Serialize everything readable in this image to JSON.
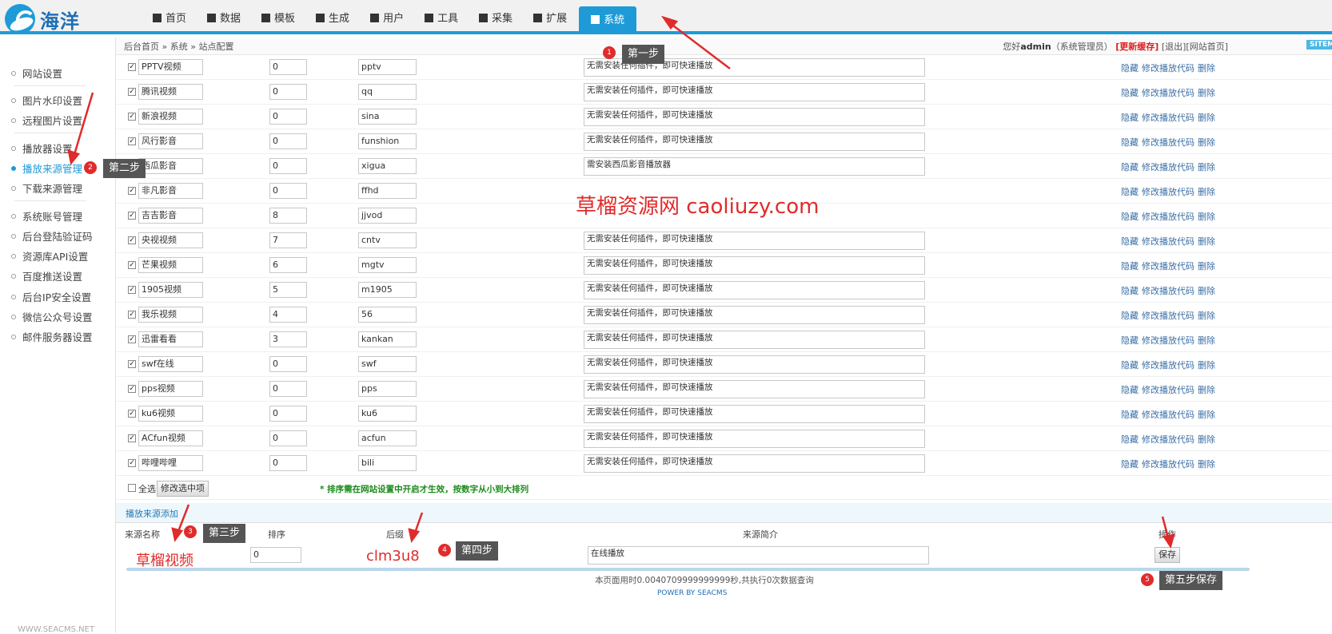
{
  "logo": {
    "text": "海洋"
  },
  "nav": [
    {
      "label": "首页",
      "icon": "home-icon"
    },
    {
      "label": "数据",
      "icon": "book-icon"
    },
    {
      "label": "模板",
      "icon": "file-icon"
    },
    {
      "label": "生成",
      "icon": "tasks-icon"
    },
    {
      "label": "用户",
      "icon": "users-icon"
    },
    {
      "label": "工具",
      "icon": "wrench-icon"
    },
    {
      "label": "采集",
      "icon": "magnet-icon"
    },
    {
      "label": "扩展",
      "icon": "sitemap-icon"
    },
    {
      "label": "系统",
      "icon": "edit-icon",
      "active": true
    }
  ],
  "breadcrumb": "后台首页 » 系统 » 站点配置",
  "user": {
    "greeting": "您好",
    "name": "admin",
    "role": "（系统管理员）",
    "refresh": "[更新缓存]",
    "logout": "[退出]",
    "site_home": "[网站首页]",
    "sitemap": "SITEMAP"
  },
  "sidebar": {
    "items": [
      "网站设置",
      "图片水印设置",
      "远程图片设置",
      "播放器设置",
      "播放来源管理",
      "下载来源管理",
      "系统账号管理",
      "后台登陆验证码",
      "资源库API设置",
      "百度推送设置",
      "后台IP安全设置",
      "微信公众号设置",
      "邮件服务器设置"
    ],
    "active_index": 4,
    "footer": "WWW.SEACMS.NET"
  },
  "sources": [
    {
      "name": "PPTV视频",
      "sort": "0",
      "code": "pptv",
      "desc": "无需安装任何插件，即可快速播放"
    },
    {
      "name": "腾讯视频",
      "sort": "0",
      "code": "qq",
      "desc": "无需安装任何插件，即可快速播放"
    },
    {
      "name": "新浪视频",
      "sort": "0",
      "code": "sina",
      "desc": "无需安装任何插件，即可快速播放"
    },
    {
      "name": "风行影音",
      "sort": "0",
      "code": "funshion",
      "desc": "无需安装任何插件，即可快速播放"
    },
    {
      "name": "西瓜影音",
      "sort": "0",
      "code": "xigua",
      "desc": "需安装西瓜影音播放器"
    },
    {
      "name": "非凡影音",
      "sort": "0",
      "code": "ffhd",
      "desc": ""
    },
    {
      "name": "吉吉影音",
      "sort": "8",
      "code": "jjvod",
      "desc": ""
    },
    {
      "name": "央视视频",
      "sort": "7",
      "code": "cntv",
      "desc": "无需安装任何插件，即可快速播放"
    },
    {
      "name": "芒果视频",
      "sort": "6",
      "code": "mgtv",
      "desc": "无需安装任何插件，即可快速播放"
    },
    {
      "name": "1905视频",
      "sort": "5",
      "code": "m1905",
      "desc": "无需安装任何插件，即可快速播放"
    },
    {
      "name": "我乐视频",
      "sort": "4",
      "code": "56",
      "desc": "无需安装任何插件，即可快速播放"
    },
    {
      "name": "迅雷看看",
      "sort": "3",
      "code": "kankan",
      "desc": "无需安装任何插件，即可快速播放"
    },
    {
      "name": "swf在线",
      "sort": "0",
      "code": "swf",
      "desc": "无需安装任何插件，即可快速播放"
    },
    {
      "name": "pps视频",
      "sort": "0",
      "code": "pps",
      "desc": "无需安装任何插件，即可快速播放"
    },
    {
      "name": "ku6视频",
      "sort": "0",
      "code": "ku6",
      "desc": "无需安装任何插件，即可快速播放"
    },
    {
      "name": "ACfun视频",
      "sort": "0",
      "code": "acfun",
      "desc": "无需安装任何插件，即可快速播放"
    },
    {
      "name": "哔哩哔哩",
      "sort": "0",
      "code": "bili",
      "desc": "无需安装任何插件，即可快速播放"
    }
  ],
  "row_ops": {
    "hide": "隐藏",
    "edit": "修改播放代码",
    "delete": "删除"
  },
  "bulk": {
    "select_all": "全选",
    "modify_btn": "修改选中项",
    "note": "* 排序需在网站设置中开启才生效，按数字从小到大排列"
  },
  "add": {
    "title": "播放来源添加",
    "headers": {
      "name": "来源名称",
      "sort": "排序",
      "code": "后缀",
      "desc": "来源简介",
      "op": "操作"
    },
    "name_value": "草榴视频",
    "sort_value": "0",
    "code_value": "clm3u8",
    "desc_value": "在线播放",
    "save_btn": "保存"
  },
  "watermark": "草榴资源网 caoliuzy.com",
  "annotations": [
    {
      "num": "1",
      "text": "第一步"
    },
    {
      "num": "2",
      "text": "第二步"
    },
    {
      "num": "3",
      "text": "第三步"
    },
    {
      "num": "4",
      "text": "第四步"
    },
    {
      "num": "5",
      "text": "第五步保存"
    }
  ],
  "footer": {
    "timing": "本页面用时0.0040709999999999秒,共执行0次数据查询",
    "powered": "POWER BY SEACMS"
  }
}
